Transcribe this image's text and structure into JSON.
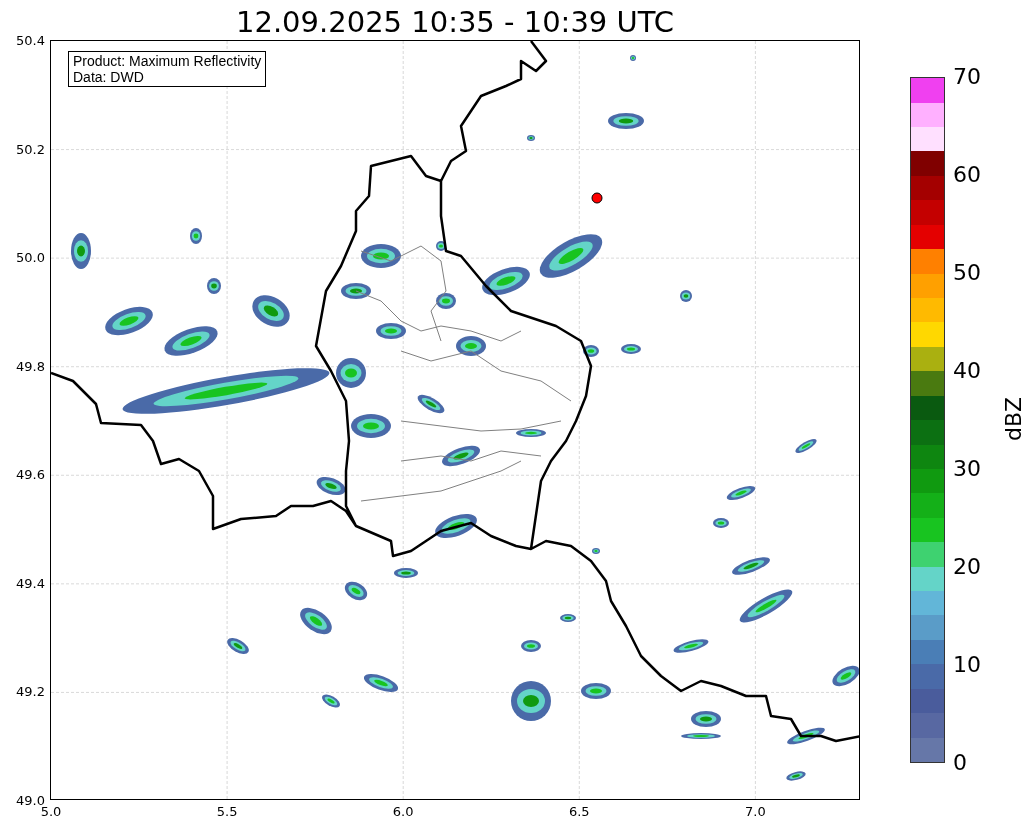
{
  "title": "12.09.2025 10:35 - 10:39 UTC",
  "info_box": [
    "Product: Maximum Reflectivity",
    "Data: DWD"
  ],
  "map": {
    "x_ticks": [
      "5.0",
      "5.5",
      "6.0",
      "6.5",
      "7.0"
    ],
    "y_ticks": [
      "50.4",
      "50.2",
      "50.0",
      "49.8",
      "49.6",
      "49.4",
      "49.2",
      "49.0"
    ]
  },
  "colorbar": {
    "label": "dBZ",
    "ticks": [
      "70",
      "60",
      "50",
      "40",
      "30",
      "20",
      "10",
      "0"
    ],
    "segments": [
      {
        "color": "#6677a8"
      },
      {
        "color": "#5868a2"
      },
      {
        "color": "#4a5c9c"
      },
      {
        "color": "#4a6aa8"
      },
      {
        "color": "#4a7eb6"
      },
      {
        "color": "#5a9cc8"
      },
      {
        "color": "#62b6d8"
      },
      {
        "color": "#64d4c8"
      },
      {
        "color": "#3ed270"
      },
      {
        "color": "#18c420"
      },
      {
        "color": "#14b018"
      },
      {
        "color": "#109a10"
      },
      {
        "color": "#0e8610"
      },
      {
        "color": "#0c7012"
      },
      {
        "color": "#0a5a10"
      },
      {
        "color": "#4a7a10"
      },
      {
        "color": "#aab010"
      },
      {
        "color": "#ffd800"
      },
      {
        "color": "#ffba00"
      },
      {
        "color": "#ffa000"
      },
      {
        "color": "#ff8000"
      },
      {
        "color": "#e40000"
      },
      {
        "color": "#c40000"
      },
      {
        "color": "#a40000"
      },
      {
        "color": "#800000"
      },
      {
        "color": "#ffe0ff"
      },
      {
        "color": "#ffb0ff"
      },
      {
        "color": "#f040f0"
      }
    ]
  }
}
